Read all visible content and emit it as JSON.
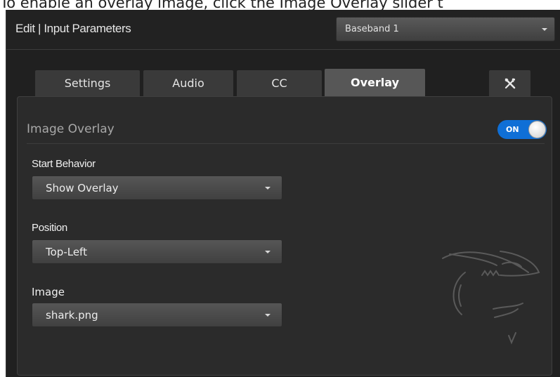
{
  "caption": "To enable an overlay image, click the Image Overlay slider t",
  "dialog": {
    "title": "Edit | Input Parameters",
    "source_select": {
      "value": "Baseband 1"
    }
  },
  "tabs": [
    {
      "label": "Settings",
      "active": false
    },
    {
      "label": "Audio",
      "active": false
    },
    {
      "label": "CC",
      "active": false
    },
    {
      "label": "Overlay",
      "active": true
    }
  ],
  "tools_tab": {
    "icon": "tools-icon"
  },
  "overlay": {
    "section_title": "Image Overlay",
    "toggle": {
      "label": "ON",
      "state": "on",
      "color": "#0f6fd6"
    },
    "fields": {
      "start_behavior": {
        "label": "Start Behavior",
        "value": "Show Overlay"
      },
      "position": {
        "label": "Position",
        "value": "Top-Left"
      },
      "image": {
        "label": "Image",
        "value": "shark.png"
      }
    },
    "watermark_icon": "shark-logo-icon"
  }
}
